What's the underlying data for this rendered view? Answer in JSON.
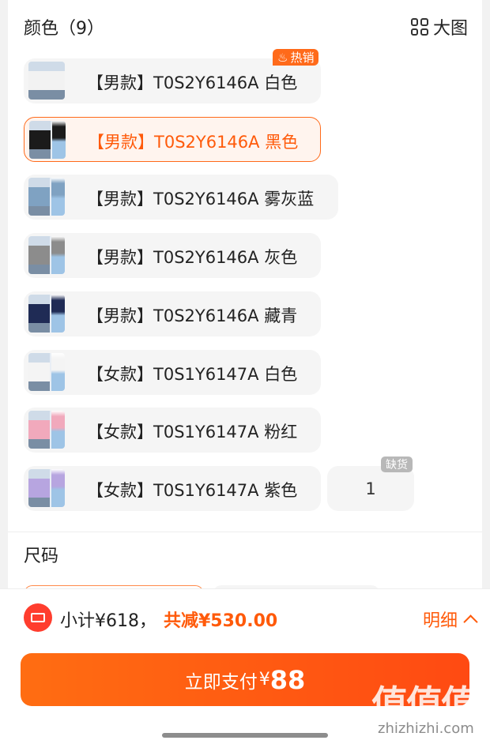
{
  "color_section": {
    "title": "颜色（9）",
    "big_view_label": "大图"
  },
  "hot_badge": "热销",
  "colors": [
    {
      "label": "【男款】T0S2Y6146A 白色",
      "selected": false,
      "swatch": "#f2f2f2"
    },
    {
      "label": "【男款】T0S2Y6146A 黑色",
      "selected": true,
      "swatch": "#1b1b1b"
    },
    {
      "label": "【男款】T0S2Y6146A 雾灰蓝",
      "selected": false,
      "swatch": "#7fa2c2"
    },
    {
      "label": "【男款】T0S2Y6146A 灰色",
      "selected": false,
      "swatch": "#8c8c8c"
    },
    {
      "label": "【男款】T0S2Y6146A 藏青",
      "selected": false,
      "swatch": "#1f2b55"
    },
    {
      "label": "【女款】T0S1Y6147A 白色",
      "selected": false,
      "swatch": "#f4f4f4"
    },
    {
      "label": "【女款】T0S1Y6147A 粉红",
      "selected": false,
      "swatch": "#f1a9bc"
    },
    {
      "label": "【女款】T0S1Y6147A 紫色",
      "selected": false,
      "swatch": "#b7a5e0"
    }
  ],
  "quantity": {
    "value": "1",
    "badge": "缺货"
  },
  "size_section": {
    "title": "尺码"
  },
  "footer": {
    "subtotal": "小计¥618，",
    "discount": "共减¥530.00",
    "detail_label": "明细",
    "pay_label": "立即支付",
    "pay_currency": "¥",
    "pay_amount": "88"
  },
  "watermark": {
    "glyph": "值值值",
    "url": "zhizhizhi.com"
  },
  "colors_theme": {
    "accent": "#ff5a0a",
    "coupon": "#ff3d2e"
  }
}
